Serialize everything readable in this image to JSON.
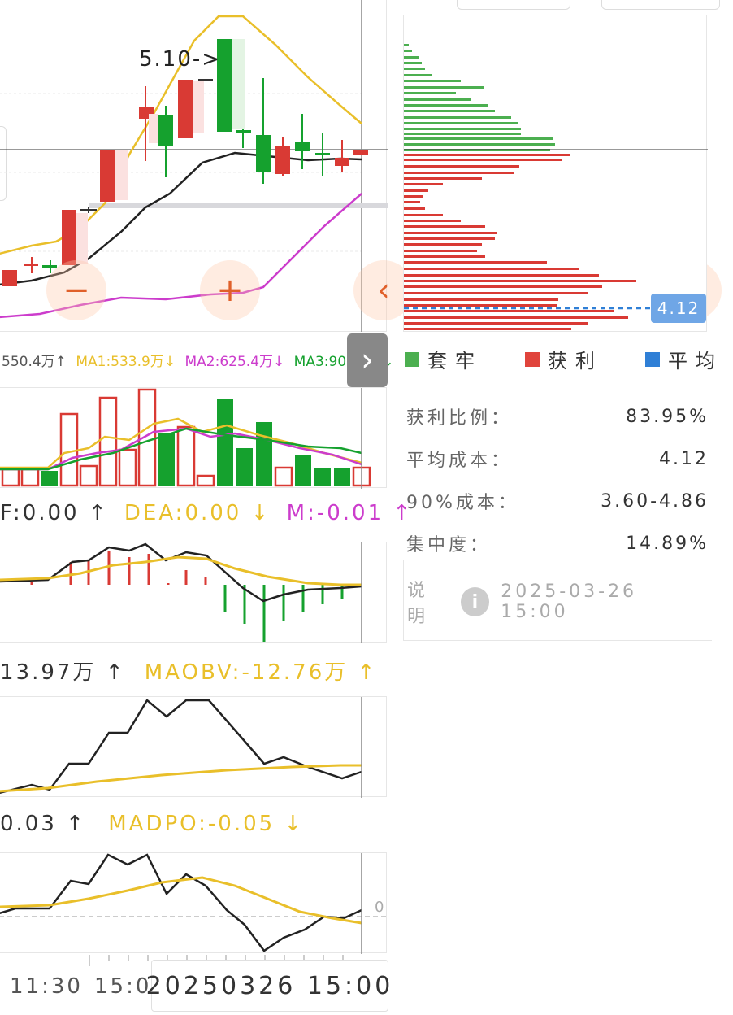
{
  "kline": {
    "price_annotation": "5.10->",
    "colors": {
      "up": "#d93a34",
      "down": "#15a12e",
      "ma1": "#e9bf2a",
      "ma2": "#222",
      "ma3": "#cc3ccc"
    }
  },
  "volume_bar": {
    "text_prefix": "550.4万↑",
    "ma1": "MA1:533.9万↓",
    "ma2": "MA2:625.4万↓",
    "ma3": "MA3:900.1万↓"
  },
  "macd": {
    "dif": "F:0.00 ↑",
    "dea": "DEA:0.00 ↓",
    "m": "M:-0.01 ↑"
  },
  "obv": {
    "obv": "13.97万 ↑",
    "maobv": "MAOBV:-12.76万 ↑"
  },
  "dpo": {
    "dpo": "0.03 ↑",
    "madpo": "MADPO:-0.05 ↓",
    "zero_label": "0"
  },
  "time_axis": {
    "label1": "11:30",
    "label2": "15:0",
    "cursor_time": "20250326 15:00"
  },
  "chip": {
    "avg_badge": "4.12",
    "legend": [
      {
        "label": "套牢",
        "color": "#4caf50",
        "icon": "green-square-icon"
      },
      {
        "label": "获利",
        "color": "#e0443c",
        "icon": "red-square-icon"
      },
      {
        "label": "平均",
        "color": "#2f7fd6",
        "icon": "blue-square-icon"
      }
    ],
    "stats": [
      {
        "label": "获利比例：",
        "value": "83.95%"
      },
      {
        "label": "平均成本：",
        "value": "4.12"
      },
      {
        "label": "90%成本：",
        "value": "3.60-4.86"
      },
      {
        "label": "集中度：",
        "value": "14.89%"
      }
    ],
    "note_label": "说明",
    "note_time": "2025-03-26 15:00"
  },
  "controls": {
    "zoom_out": "−",
    "zoom_in": "+",
    "prev": "‹",
    "next": "›",
    "expand": "⤢",
    "expand_panel": "›"
  }
}
